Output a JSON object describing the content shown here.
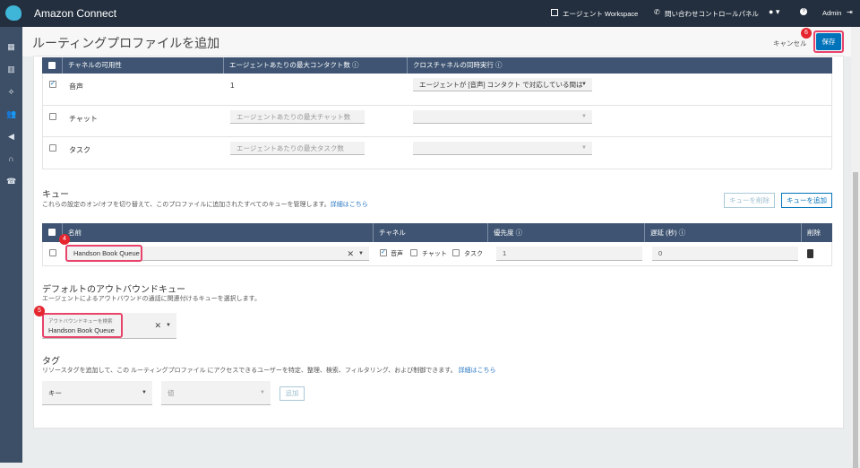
{
  "topbar": {
    "brand": "Amazon Connect",
    "workspace": "エージェント Workspace",
    "ccp": "問い合わせコントロールパネル",
    "user": "Admin"
  },
  "sidebar": {
    "icons": [
      "dashboard-icon",
      "analytics-icon",
      "routing-icon",
      "users-icon",
      "campaign-icon",
      "headset-icon",
      "phone-icon"
    ]
  },
  "page": {
    "title": "ルーティングプロファイルを追加",
    "cancel": "キャンセル",
    "save": "保存"
  },
  "channels": {
    "headers": [
      "チャネルの可用性",
      "エージェントあたりの最大コンタクト数",
      "クロスチャネルの同時実行"
    ],
    "rows": [
      {
        "name": "音声",
        "checked": true,
        "max": "1",
        "cross": "エージェントが [音声] コンタクト で対応している間は"
      },
      {
        "name": "チャット",
        "checked": false,
        "max_placeholder": "エージェントあたりの最大チャット数",
        "cross": ""
      },
      {
        "name": "タスク",
        "checked": false,
        "max_placeholder": "エージェントあたりの最大タスク数",
        "cross": ""
      }
    ]
  },
  "queues": {
    "title": "キュー",
    "desc": "これらの設定のオン/オフを切り替えて、このプロファイルに追加されたすべてのキューを管理します。",
    "link": "詳細はこちら",
    "remove_btn": "キューを削除",
    "add_btn": "キューを追加",
    "headers": [
      "名前",
      "チャネル",
      "優先度",
      "遅延 (秒)",
      "削除"
    ],
    "row": {
      "name": "Handson Book Queue",
      "ch_voice": "音声",
      "ch_chat": "チャット",
      "ch_task": "タスク",
      "priority": "1",
      "delay": "0"
    }
  },
  "outbound": {
    "title": "デフォルトのアウトバウンドキュー",
    "desc": "エージェントによるアウトバウンドの通話に関連付けるキューを選択します。",
    "label": "アウトバウンドキューを検索",
    "value": "Handson Book Queue"
  },
  "tags": {
    "title": "タグ",
    "desc": "リソースタグを追加して、この ルーティングプロファイル にアクセスできるユーザーを特定、整理、検索、フィルタリング、および制御できます。",
    "link": "詳細はこちら",
    "key": "キー",
    "value": "値",
    "add": "追加"
  },
  "annotations": {
    "a4": "4",
    "a5": "5",
    "a6": "6"
  },
  "colors": {
    "topbar": "#232f3e",
    "header": "#3e5472",
    "primary": "#0073bb",
    "highlight": "#e8436b",
    "badge": "#e5262f"
  }
}
